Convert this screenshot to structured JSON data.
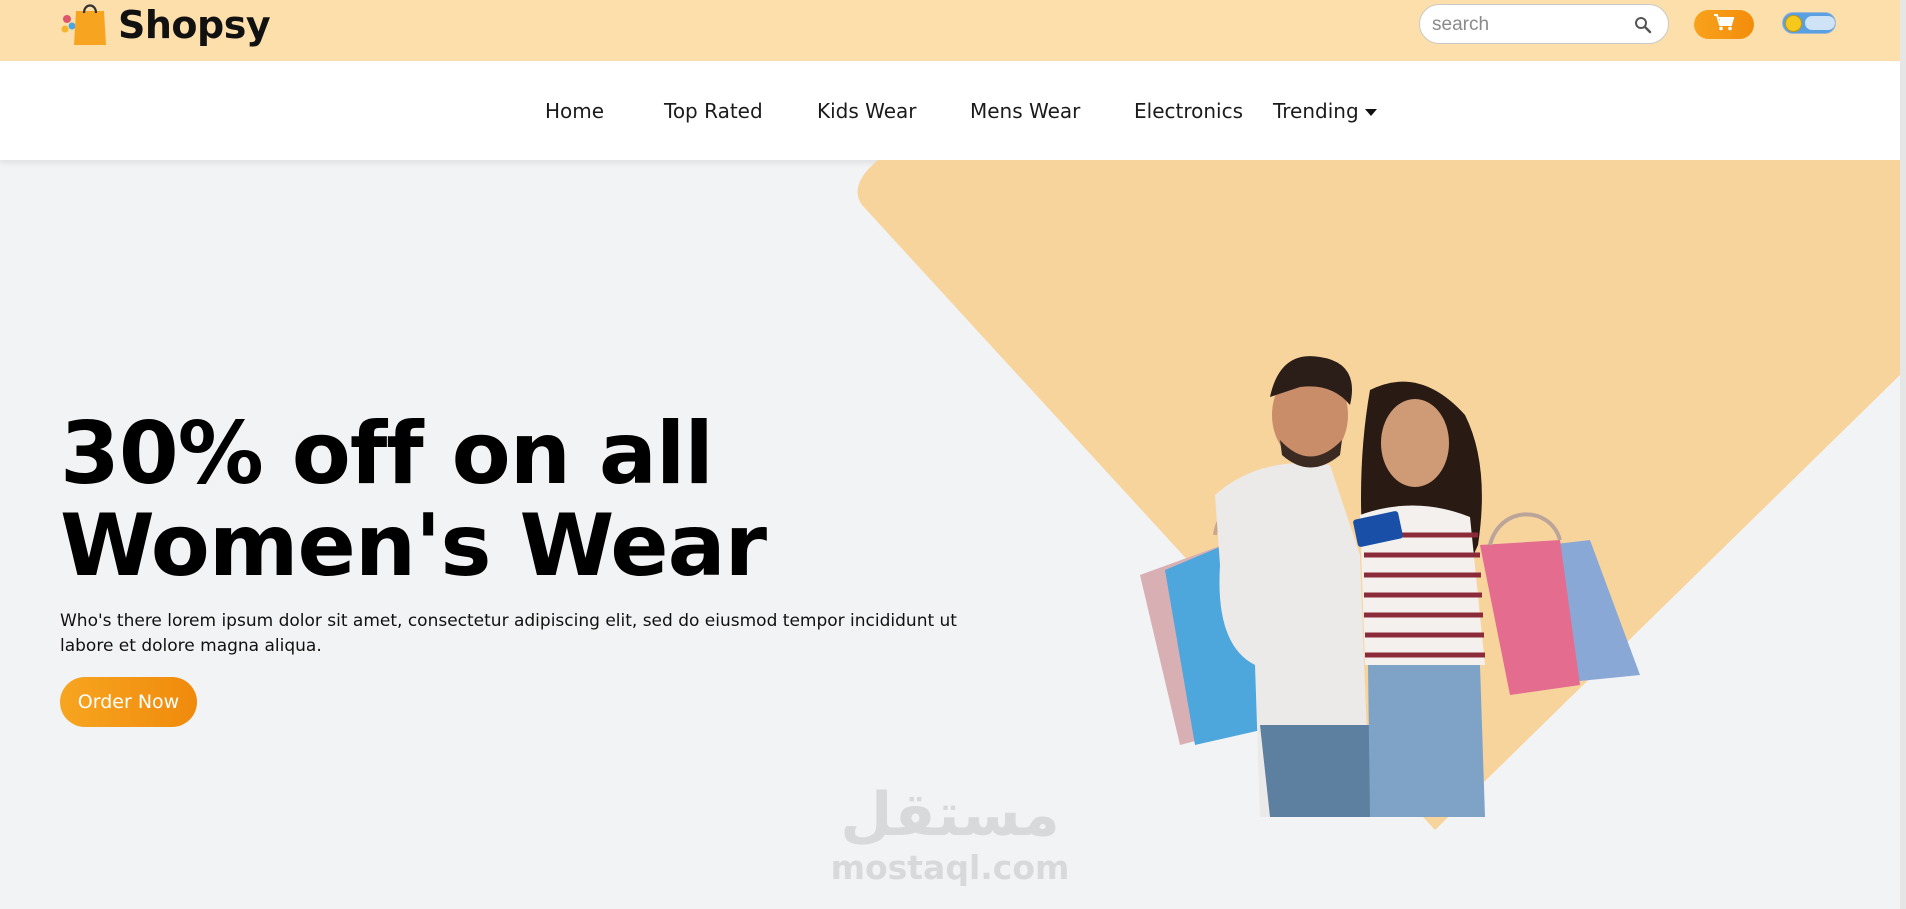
{
  "header": {
    "brand": "Shopsy",
    "search_placeholder": "search"
  },
  "nav": {
    "items": [
      "Home",
      "Top Rated",
      "Kids Wear",
      "Mens Wear",
      "Electronics",
      "Trending"
    ]
  },
  "hero": {
    "headline_line1": "30% off on all",
    "headline_line2": "Women's Wear",
    "description": "Who's there lorem ipsum dolor sit amet, consectetur adipiscing elit, sed do eiusmod tempor incididunt ut labore et dolore magna aliqua.",
    "cta": "Order Now"
  },
  "watermark": {
    "arabic": "مستقل",
    "latin": "mostaql.com"
  },
  "colors": {
    "topbar": "#fddfab",
    "accent": "#f7a520",
    "hero_shape": "#f8d49d",
    "page_bg": "#f2f3f5"
  },
  "icons": [
    "shopping-bag-logo-icon",
    "search-icon",
    "cart-icon",
    "theme-toggle-icon",
    "chevron-down-icon"
  ]
}
